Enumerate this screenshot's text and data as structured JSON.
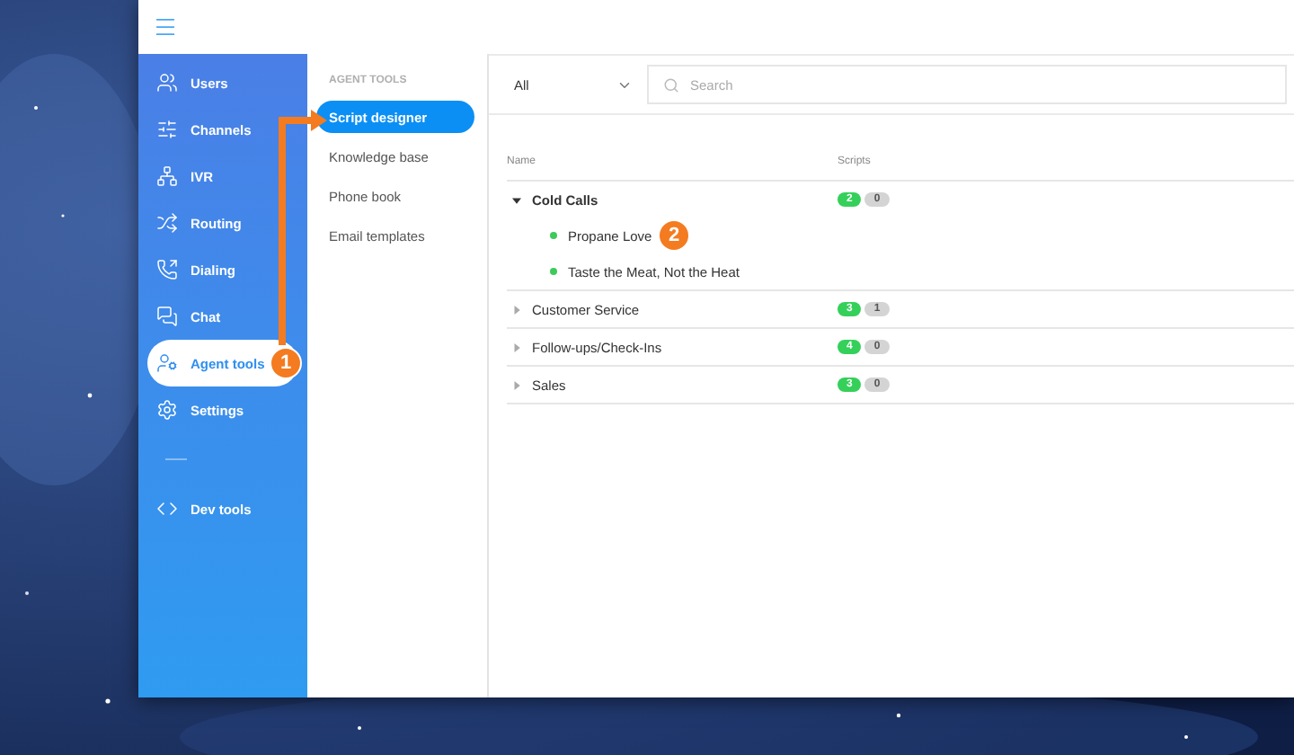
{
  "sidebar": {
    "items": [
      {
        "label": "Users",
        "selected": false
      },
      {
        "label": "Channels",
        "selected": false
      },
      {
        "label": "IVR",
        "selected": false
      },
      {
        "label": "Routing",
        "selected": false
      },
      {
        "label": "Dialing",
        "selected": false
      },
      {
        "label": "Chat",
        "selected": false
      },
      {
        "label": "Agent tools",
        "selected": true,
        "callout": "1"
      },
      {
        "label": "Settings",
        "selected": false
      }
    ],
    "footer_items": [
      {
        "label": "Dev tools",
        "selected": false
      }
    ]
  },
  "submenu": {
    "heading": "AGENT TOOLS",
    "items": [
      {
        "label": "Script designer",
        "selected": true
      },
      {
        "label": "Knowledge base",
        "selected": false
      },
      {
        "label": "Phone book",
        "selected": false
      },
      {
        "label": "Email templates",
        "selected": false
      }
    ]
  },
  "toolbar": {
    "filter": {
      "value": "All"
    },
    "search": {
      "placeholder": "Search"
    }
  },
  "table": {
    "columns": [
      "Name",
      "Scripts"
    ],
    "rows": [
      {
        "name": "Cold Calls",
        "expanded": true,
        "active": "2",
        "inactive": "0",
        "children": [
          {
            "name": "Propane Love",
            "callout": "2"
          },
          {
            "name": "Taste the Meat, Not the Heat"
          }
        ]
      },
      {
        "name": "Customer Service",
        "expanded": false,
        "active": "3",
        "inactive": "1"
      },
      {
        "name": "Follow-ups/Check-Ins",
        "expanded": false,
        "active": "4",
        "inactive": "0"
      },
      {
        "name": "Sales",
        "expanded": false,
        "active": "3",
        "inactive": "0"
      }
    ]
  }
}
